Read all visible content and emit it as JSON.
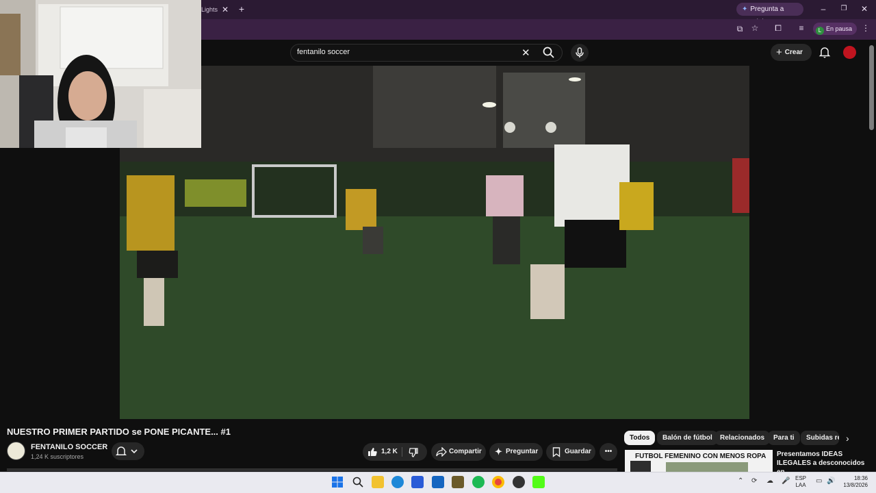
{
  "browser": {
    "tab_title": "Lights",
    "gemini_label": "Pregunta a Gemini",
    "profile_initial": "L",
    "profile_status": "En pausa"
  },
  "youtube": {
    "search_query": "fentanilo soccer",
    "create_label": "Crear"
  },
  "video": {
    "title": "NUESTRO PRIMER PARTIDO se PONE PICANTE... #1",
    "channel_name": "FENTANILO SOCCER",
    "subscribers": "1,24 K suscriptores",
    "likes": "1,2 K",
    "share_label": "Compartir",
    "ask_label": "Preguntar",
    "save_label": "Guardar"
  },
  "chips": [
    "Todos",
    "Balón de fútbol",
    "Relacionados",
    "Para ti",
    "Subidas re"
  ],
  "recommendation": {
    "thumb_text": "FUTBOL FEMENINO CON MENOS ROPA",
    "title": "Presentamos IDEAS ILEGALES a desconocidos en"
  },
  "taskbar": {
    "lang_top": "ESP",
    "lang_bottom": "LAA",
    "time": "18:36",
    "date": "13/8/2026"
  },
  "icons": [
    "search-icon",
    "mic-icon",
    "bell-icon",
    "like-icon",
    "dislike-icon",
    "share-icon",
    "sparkle-icon",
    "save-icon",
    "more-icon",
    "windows-start-icon"
  ],
  "colors": {
    "browser_chrome": "#2b1a33",
    "yt_background": "#0f0f0f",
    "pill_background": "#272727",
    "taskbar": "#eaeaf0"
  }
}
